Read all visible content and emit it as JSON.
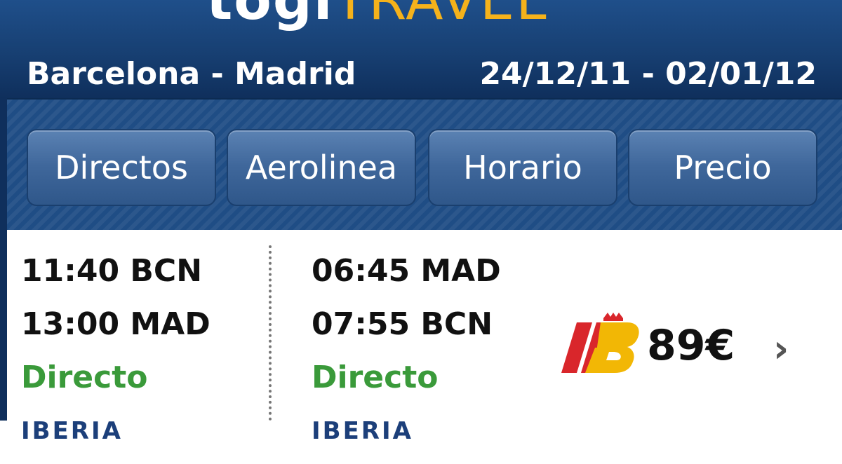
{
  "header": {
    "logo_brand": "togi",
    "logo_accent": "TRAVEL",
    "route": "Barcelona - Madrid",
    "dates": "24/12/11 - 02/01/12"
  },
  "filters": [
    "Directos",
    "Aerolinea",
    "Horario",
    "Precio"
  ],
  "result": {
    "outbound": {
      "depart": "11:40 BCN",
      "arrive": "13:00 MAD",
      "type": "Directo",
      "airline": "IBERIA"
    },
    "return": {
      "depart": "06:45 MAD",
      "arrive": "07:55 BCN",
      "type": "Directo",
      "airline": "IBERIA"
    },
    "price": "89€",
    "airline_logo": "iberia-logo"
  },
  "colors": {
    "header_blue": "#173f72",
    "logo_accent": "#f5b21b",
    "direct_green": "#3a9a3a",
    "airline_blue": "#1c3f7a"
  }
}
